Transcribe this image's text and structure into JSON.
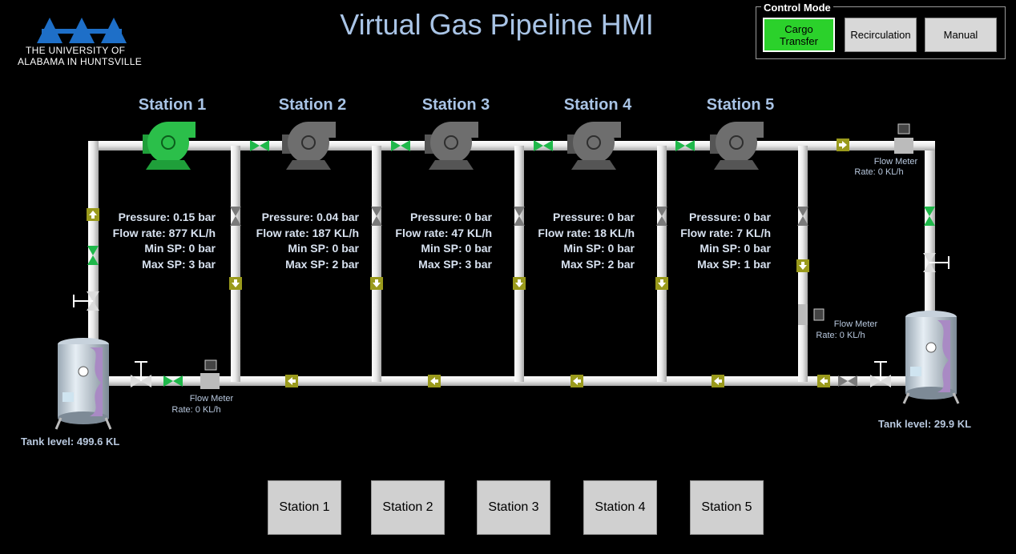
{
  "title": "Virtual Gas Pipeline HMI",
  "logo": {
    "mark": "UAH",
    "line1": "THE UNIVERSITY OF",
    "line2": "ALABAMA IN HUNTSVILLE"
  },
  "control_mode": {
    "legend": "Control Mode",
    "buttons": [
      {
        "label": "Cargo Transfer",
        "active": true
      },
      {
        "label": "Recirculation",
        "active": false
      },
      {
        "label": "Manual",
        "active": false
      }
    ]
  },
  "stations": [
    {
      "name": "Station 1",
      "pump_state": "running",
      "pressure": "Pressure: 0.15 bar",
      "flow": "Flow rate: 877 KL/h",
      "min_sp": "Min SP: 0 bar",
      "max_sp": "Max SP: 3 bar"
    },
    {
      "name": "Station 2",
      "pump_state": "stopped",
      "pressure": "Pressure: 0.04 bar",
      "flow": "Flow rate: 187 KL/h",
      "min_sp": "Min SP: 0 bar",
      "max_sp": "Max SP: 2 bar"
    },
    {
      "name": "Station 3",
      "pump_state": "stopped",
      "pressure": "Pressure: 0 bar",
      "flow": "Flow rate: 47 KL/h",
      "min_sp": "Min SP: 0 bar",
      "max_sp": "Max SP: 3 bar"
    },
    {
      "name": "Station 4",
      "pump_state": "stopped",
      "pressure": "Pressure: 0 bar",
      "flow": "Flow rate: 18 KL/h",
      "min_sp": "Min SP: 0 bar",
      "max_sp": "Max SP: 2 bar"
    },
    {
      "name": "Station 5",
      "pump_state": "stopped",
      "pressure": "Pressure: 0 bar",
      "flow": "Flow rate: 7 KL/h",
      "min_sp": "Min SP: 0 bar",
      "max_sp": "Max SP: 1 bar"
    }
  ],
  "flow_meters": {
    "left": {
      "label": "Flow Meter",
      "rate": "Rate: 0 KL/h"
    },
    "top_right": {
      "label": "Flow Meter",
      "rate": "Rate: 0 KL/h"
    },
    "mid_right": {
      "label": "Flow Meter",
      "rate": "Rate: 0 KL/h"
    }
  },
  "tanks": {
    "left": {
      "level": "Tank level: 499.6 KL"
    },
    "right": {
      "level": "Tank level: 29.9 KL"
    }
  },
  "station_buttons": [
    "Station 1",
    "Station 2",
    "Station 3",
    "Station 4",
    "Station 5"
  ],
  "colors": {
    "pump_running": "#2bbf4a",
    "pump_stopped": "#6e6e6e",
    "valve_open": "#1fb84a",
    "valve_closed": "#7a7a7a",
    "arrow_box": "#9a9a1c",
    "pipe": "#e6e6e6",
    "active_mode": "#2bd12b"
  }
}
